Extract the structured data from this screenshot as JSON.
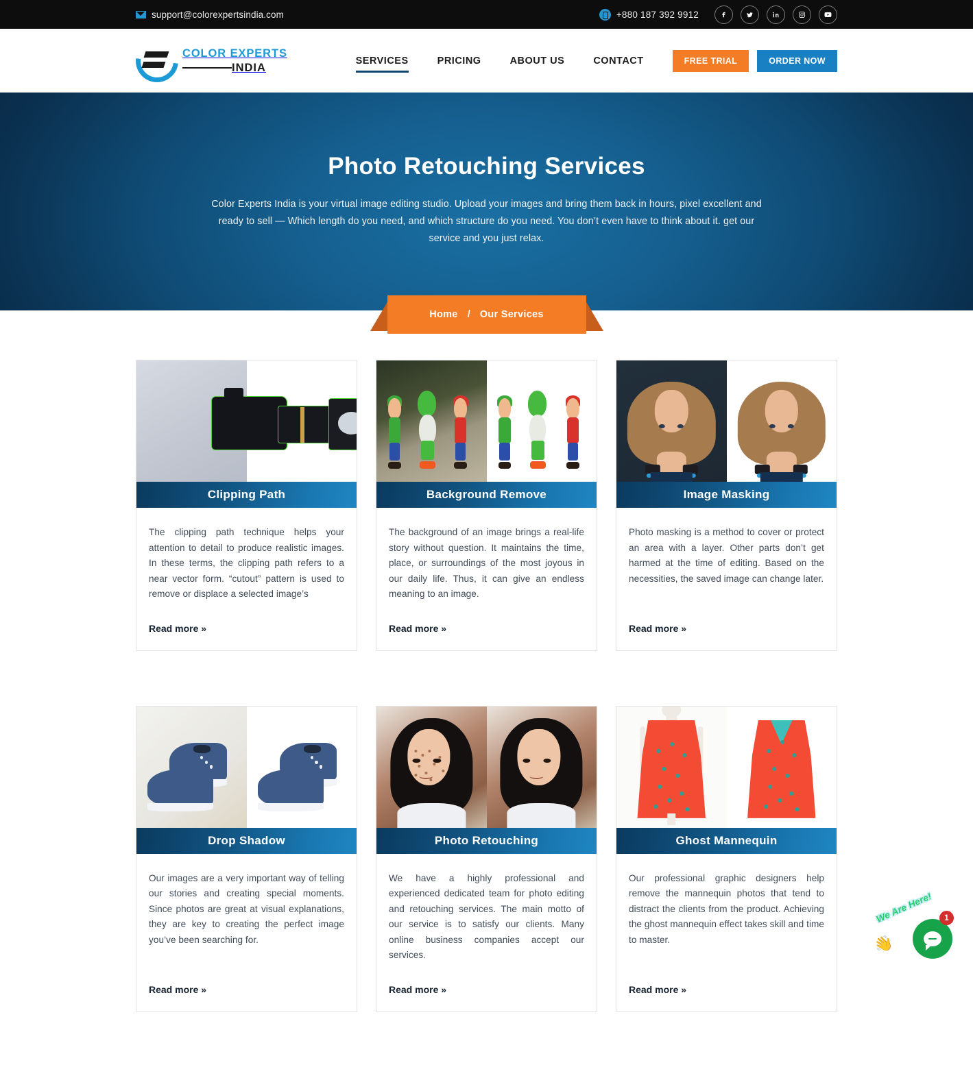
{
  "topbar": {
    "email": "support@colorexpertsindia.com",
    "phone": "+880 187 392 9912",
    "socials": [
      {
        "name": "facebook",
        "label": "f"
      },
      {
        "name": "twitter",
        "label": "t"
      },
      {
        "name": "linkedin",
        "label": "in"
      },
      {
        "name": "instagram",
        "label": "ig"
      },
      {
        "name": "youtube",
        "label": "yt"
      }
    ]
  },
  "header": {
    "logo_top": "COLOR EXPERTS",
    "logo_bottom": "INDIA",
    "nav": [
      {
        "label": "SERVICES",
        "active": true
      },
      {
        "label": "PRICING",
        "active": false
      },
      {
        "label": "ABOUT US",
        "active": false
      },
      {
        "label": "CONTACT",
        "active": false
      }
    ],
    "free_trial": "FREE TRIAL",
    "order_now": "ORDER NOW"
  },
  "hero": {
    "title": "Photo Retouching Services",
    "description": "Color Experts India is your virtual image editing studio. Upload your images and bring them back in hours, pixel excellent and ready to sell — Which length do you need, and which structure do you need. You don’t even have to think about it. get our service and you just relax.",
    "breadcrumb": {
      "home": "Home",
      "separator": "/",
      "current": "Our Services"
    }
  },
  "cards": [
    {
      "title": "Clipping Path",
      "text": "The clipping path technique helps your attention to detail to produce realistic images. In these terms, the clipping path refers to a near vector form. “cutout” pattern is used to remove or displace a selected image’s",
      "read_more": "Read more »",
      "image_alt": "camera-before-after"
    },
    {
      "title": "Background Remove",
      "text": "The background of an image brings a real-life story without question. It maintains the time, place, or surroundings of the most joyous in our daily life. Thus, it can give an endless meaning to an image.",
      "read_more": "Read more »",
      "image_alt": "figurines-before-after"
    },
    {
      "title": "Image Masking",
      "text": "Photo masking is a method to cover or protect an area with a layer. Other parts don’t get harmed at the time of editing. Based on the necessities, the saved image can change later.",
      "read_more": "Read more »",
      "image_alt": "portrait-before-after"
    },
    {
      "title": "Drop Shadow",
      "text": "Our images are a very important way of telling our stories and creating special moments. Since photos are great at visual explanations, they are key to creating the perfect image you’ve been searching for.",
      "read_more": "Read more »",
      "image_alt": "shoes-before-after"
    },
    {
      "title": "Photo Retouching",
      "text": "We have a highly professional and experienced dedicated team for photo editing and retouching services. The main motto of our service is to satisfy our clients. Many online business companies accept our services.",
      "read_more": "Read more »",
      "image_alt": "skin-retouch-before-after"
    },
    {
      "title": "Ghost Mannequin",
      "text": "Our professional graphic designers help remove the mannequin photos that tend to distract the clients from the product. Achieving the ghost mannequin effect takes skill and time to master.",
      "read_more": "Read more »",
      "image_alt": "dress-before-after"
    }
  ],
  "chat": {
    "tagline": "We Are Here!",
    "badge": "1",
    "hand": "👋"
  },
  "colors": {
    "topbar_bg": "#0d0d0d",
    "accent_blue": "#1c9ad6",
    "accent_orange": "#f47c24",
    "order_blue": "#1a80c4",
    "hero_dark": "#08253f",
    "hero_light": "#1a6fa3",
    "card_title_dark": "#0b3a5e",
    "card_title_light": "#1f86c2",
    "chat_green": "#16a34a",
    "badge_red": "#d32f2f"
  }
}
